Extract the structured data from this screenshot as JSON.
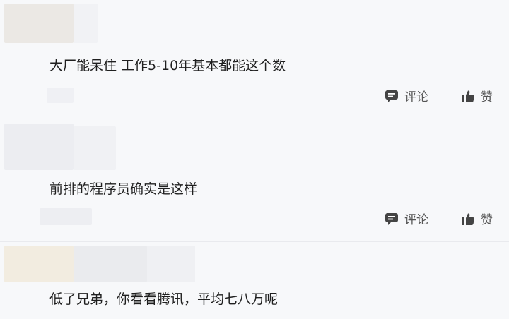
{
  "colors": {
    "background": "#f7f8fa",
    "text": "#1f1f1f",
    "action_text": "#555555",
    "icon": "#444444"
  },
  "comments": [
    {
      "text": "大厂能呆住 工作5-10年基本都能这个数",
      "actions": {
        "comment_icon": "comment-bubble-icon",
        "comment_label": "评论",
        "like_icon": "thumbs-up-icon",
        "like_label": "赞"
      }
    },
    {
      "text": "前排的程序员确实是这样",
      "actions": {
        "comment_icon": "comment-bubble-icon",
        "comment_label": "评论",
        "like_icon": "thumbs-up-icon",
        "like_label": "赞"
      }
    },
    {
      "text": "低了兄弟，你看看腾讯，平均七八万呢"
    }
  ]
}
